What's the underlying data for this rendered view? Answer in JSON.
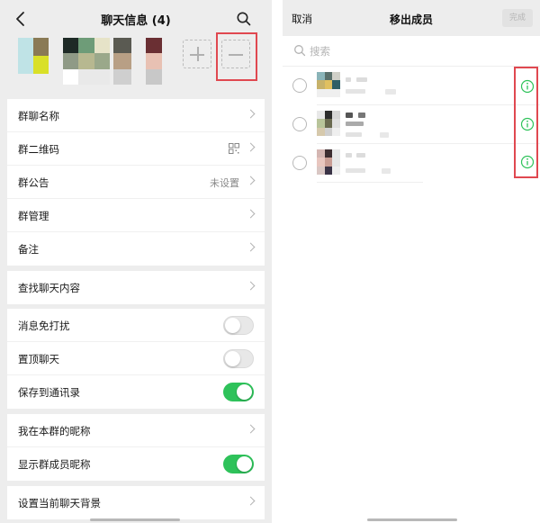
{
  "left": {
    "header": {
      "title": "聊天信息 (4)",
      "back_icon": "chevron-left-icon",
      "search_icon": "search-icon"
    },
    "members": {
      "add_icon": "plus-icon",
      "remove_icon": "minus-icon"
    },
    "groups": [
      {
        "rows": [
          {
            "label": "群聊名称",
            "value": ""
          },
          {
            "label": "群二维码",
            "value": "",
            "icon": "qr-code-icon"
          },
          {
            "label": "群公告",
            "value": "未设置"
          },
          {
            "label": "群管理",
            "value": ""
          },
          {
            "label": "备注",
            "value": ""
          }
        ]
      },
      {
        "rows": [
          {
            "label": "查找聊天内容",
            "value": ""
          }
        ]
      },
      {
        "rows": [
          {
            "label": "消息免打扰",
            "toggle": false
          },
          {
            "label": "置顶聊天",
            "toggle": false
          },
          {
            "label": "保存到通讯录",
            "toggle": true
          }
        ]
      },
      {
        "rows": [
          {
            "label": "我在本群的昵称",
            "value": ""
          },
          {
            "label": "显示群成员昵称",
            "toggle": true
          }
        ]
      },
      {
        "rows": [
          {
            "label": "设置当前聊天背景",
            "value": ""
          }
        ]
      }
    ]
  },
  "right": {
    "header": {
      "cancel": "取消",
      "title": "移出成员",
      "done": "完成"
    },
    "search": {
      "placeholder": "搜索",
      "icon": "search-icon"
    },
    "member_count": 3,
    "info_icon": "info-circle-icon"
  },
  "colors": {
    "toggle_on": "#2ec25a",
    "highlight_border": "#e04850",
    "info_icon": "#2ec25a",
    "background": "#ededed"
  }
}
